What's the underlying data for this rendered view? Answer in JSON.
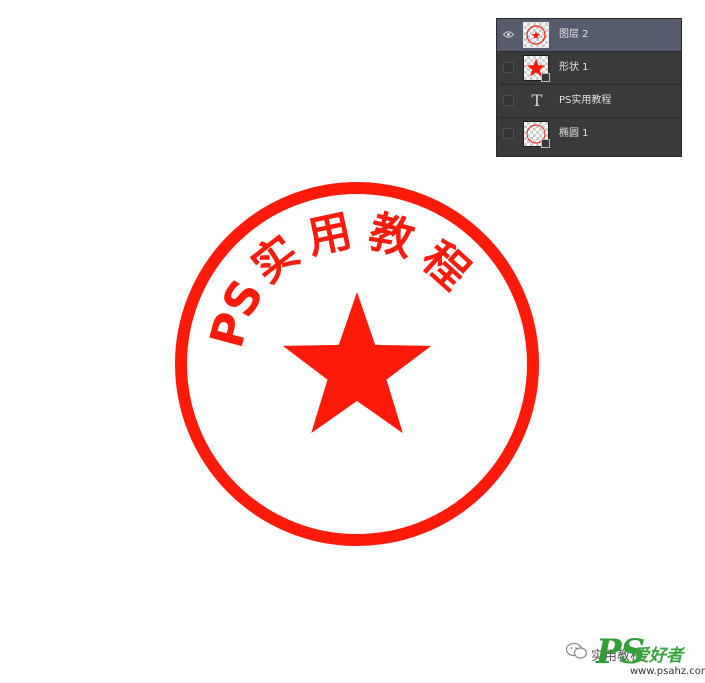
{
  "layers_panel": {
    "layers": [
      {
        "name": "图层 2",
        "kind": "raster",
        "visible": true,
        "selected": true,
        "thumb_icon": "seal-thumbnail-icon"
      },
      {
        "name": "形状 1",
        "kind": "shape",
        "visible": false,
        "selected": false,
        "thumb_icon": "star-thumbnail-icon"
      },
      {
        "name": "PS实用教程",
        "kind": "text",
        "visible": false,
        "selected": false,
        "thumb_icon": "text-layer-icon"
      },
      {
        "name": "椭圆 1",
        "kind": "shape",
        "visible": false,
        "selected": false,
        "thumb_icon": "ellipse-thumbnail-icon"
      }
    ],
    "type_glyph": "T",
    "eye_icon": "eye-icon"
  },
  "seal": {
    "arc_chars": [
      "P",
      "S",
      "实",
      "用",
      "教",
      "程"
    ],
    "color": "#ff1a0a"
  },
  "watermark": {
    "name": "实用教程",
    "brand_ps": "PS",
    "brand_cn": "爱好者",
    "url": "www.psahz.com",
    "icon": "wechat-icon"
  },
  "colors": {
    "panel_bg": "#3a3a3a",
    "selected_row": "#565b6e",
    "seal_red": "#ff1a0a",
    "brand_green": "#2f9e35"
  }
}
